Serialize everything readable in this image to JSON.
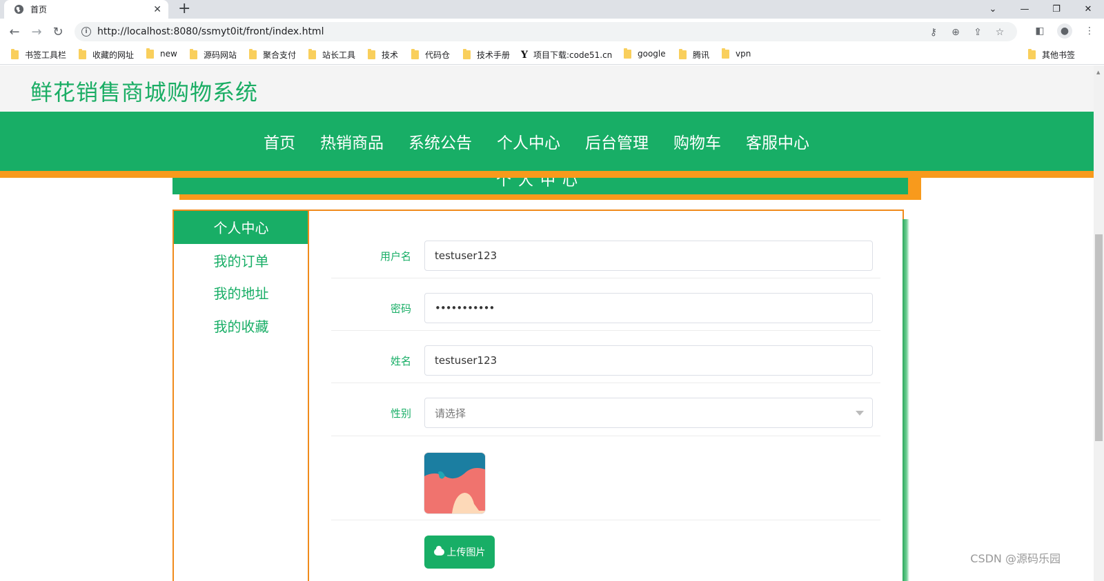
{
  "browser": {
    "tab_title": "首页",
    "tab_close": "✕",
    "new_tab": "+",
    "url": "http://localhost:8080/ssmyt0it/front/index.html",
    "bookmarks": [
      {
        "label": "书签工具栏",
        "icon": "folder-icon"
      },
      {
        "label": "收藏的网址",
        "icon": "folder-icon"
      },
      {
        "label": "new",
        "icon": "folder-icon"
      },
      {
        "label": "源码网站",
        "icon": "folder-icon"
      },
      {
        "label": "聚合支付",
        "icon": "folder-icon"
      },
      {
        "label": "站长工具",
        "icon": "folder-icon"
      },
      {
        "label": "技术",
        "icon": "folder-icon"
      },
      {
        "label": "代码仓",
        "icon": "folder-icon"
      },
      {
        "label": "技术手册",
        "icon": "folder-icon"
      },
      {
        "label": "项目下载:code51.cn",
        "icon": "y-logo-icon"
      },
      {
        "label": "google",
        "icon": "folder-icon"
      },
      {
        "label": "腾讯",
        "icon": "folder-icon"
      },
      {
        "label": "vpn",
        "icon": "folder-icon"
      }
    ],
    "other_bookmarks": "其他书签"
  },
  "site": {
    "title": "鲜花销售商城购物系统",
    "nav": [
      "首页",
      "热销商品",
      "系统公告",
      "个人中心",
      "后台管理",
      "购物车",
      "客服中心"
    ],
    "section_title": "个人中心"
  },
  "sidebar": {
    "items": [
      {
        "label": "个人中心",
        "active": true
      },
      {
        "label": "我的订单",
        "active": false
      },
      {
        "label": "我的地址",
        "active": false
      },
      {
        "label": "我的收藏",
        "active": false
      }
    ]
  },
  "form": {
    "username": {
      "label": "用户名",
      "value": "testuser123"
    },
    "password": {
      "label": "密码",
      "value": "•••••••••••"
    },
    "name": {
      "label": "姓名",
      "value": "testuser123"
    },
    "gender": {
      "label": "性别",
      "placeholder": "请选择"
    },
    "upload_label": "上传图片"
  },
  "watermark": "CSDN @源码乐园",
  "colors": {
    "primary": "#18ae66",
    "accent": "#f89a1c"
  }
}
